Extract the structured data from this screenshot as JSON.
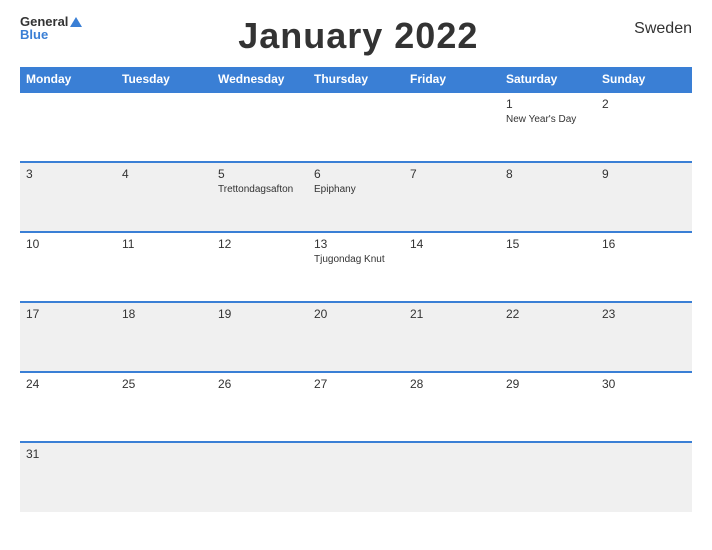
{
  "header": {
    "logo_general": "General",
    "logo_blue": "Blue",
    "title": "January 2022",
    "country": "Sweden"
  },
  "weekdays": [
    "Monday",
    "Tuesday",
    "Wednesday",
    "Thursday",
    "Friday",
    "Saturday",
    "Sunday"
  ],
  "weeks": [
    [
      {
        "day": "",
        "events": []
      },
      {
        "day": "",
        "events": []
      },
      {
        "day": "",
        "events": []
      },
      {
        "day": "",
        "events": []
      },
      {
        "day": "",
        "events": []
      },
      {
        "day": "1",
        "events": [
          "New Year's Day"
        ]
      },
      {
        "day": "2",
        "events": []
      }
    ],
    [
      {
        "day": "3",
        "events": []
      },
      {
        "day": "4",
        "events": []
      },
      {
        "day": "5",
        "events": [
          "Trettondagsafton"
        ]
      },
      {
        "day": "6",
        "events": [
          "Epiphany"
        ]
      },
      {
        "day": "7",
        "events": []
      },
      {
        "day": "8",
        "events": []
      },
      {
        "day": "9",
        "events": []
      }
    ],
    [
      {
        "day": "10",
        "events": []
      },
      {
        "day": "11",
        "events": []
      },
      {
        "day": "12",
        "events": []
      },
      {
        "day": "13",
        "events": [
          "Tjugondag Knut"
        ]
      },
      {
        "day": "14",
        "events": []
      },
      {
        "day": "15",
        "events": []
      },
      {
        "day": "16",
        "events": []
      }
    ],
    [
      {
        "day": "17",
        "events": []
      },
      {
        "day": "18",
        "events": []
      },
      {
        "day": "19",
        "events": []
      },
      {
        "day": "20",
        "events": []
      },
      {
        "day": "21",
        "events": []
      },
      {
        "day": "22",
        "events": []
      },
      {
        "day": "23",
        "events": []
      }
    ],
    [
      {
        "day": "24",
        "events": []
      },
      {
        "day": "25",
        "events": []
      },
      {
        "day": "26",
        "events": []
      },
      {
        "day": "27",
        "events": []
      },
      {
        "day": "28",
        "events": []
      },
      {
        "day": "29",
        "events": []
      },
      {
        "day": "30",
        "events": []
      }
    ],
    [
      {
        "day": "31",
        "events": []
      },
      {
        "day": "",
        "events": []
      },
      {
        "day": "",
        "events": []
      },
      {
        "day": "",
        "events": []
      },
      {
        "day": "",
        "events": []
      },
      {
        "day": "",
        "events": []
      },
      {
        "day": "",
        "events": []
      }
    ]
  ],
  "colors": {
    "header_bg": "#3a7fd5",
    "accent": "#3a7fd5",
    "even_row": "#f0f0f0",
    "odd_row": "#ffffff"
  }
}
